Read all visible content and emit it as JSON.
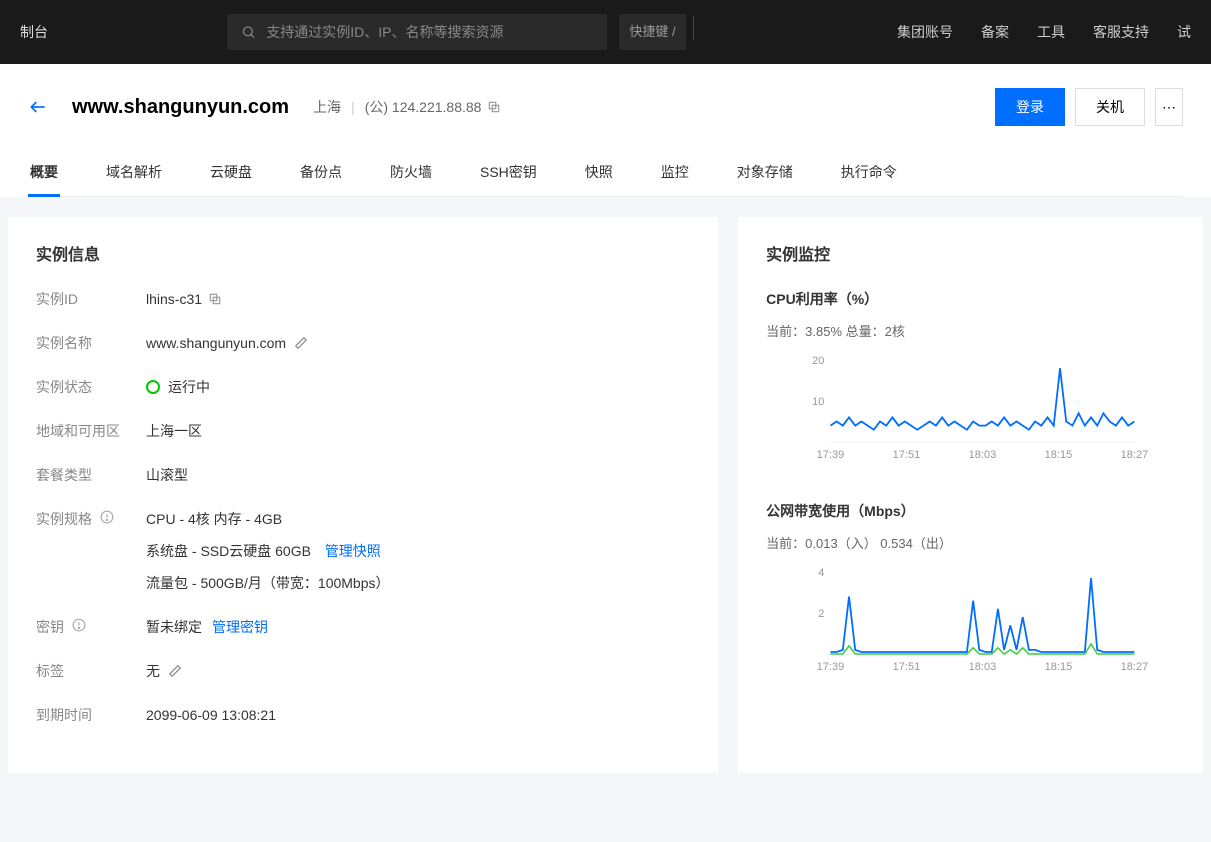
{
  "topbar": {
    "console": "制台",
    "search_placeholder": "支持通过实例ID、IP、名称等搜索资源",
    "shortcut": "快捷键 /",
    "links": [
      "集团账号",
      "备案",
      "工具",
      "客服支持",
      "试"
    ]
  },
  "header": {
    "title": "www.shangunyun.com",
    "region": "上海",
    "ip_label": "(公) 124.221.88.88",
    "login": "登录",
    "shutdown": "关机"
  },
  "tabs": [
    "概要",
    "域名解析",
    "云硬盘",
    "备份点",
    "防火墙",
    "SSH密钥",
    "快照",
    "监控",
    "对象存储",
    "执行命令"
  ],
  "info": {
    "panel_title": "实例信息",
    "rows": {
      "instance_id_label": "实例ID",
      "instance_id": "lhins-c31",
      "name_label": "实例名称",
      "name": "www.shangunyun.com",
      "status_label": "实例状态",
      "status": "运行中",
      "zone_label": "地域和可用区",
      "zone": "上海一区",
      "plan_label": "套餐类型",
      "plan": "山滚型",
      "spec_label": "实例规格",
      "spec_cpu": "CPU - 4核 内存 - 4GB",
      "spec_disk": "系统盘 - SSD云硬盘 60GB",
      "spec_disk_link": "管理快照",
      "spec_bw": "流量包 - 500GB/月（带宽：100Mbps）",
      "key_label": "密钥",
      "key": "暂未绑定",
      "key_link": "管理密钥",
      "tag_label": "标签",
      "tag": "无",
      "expire_label": "到期时间",
      "expire": "2099-06-09 13:08:21"
    }
  },
  "monitor": {
    "panel_title": "实例监控",
    "cpu_title": "CPU利用率（%）",
    "cpu_sub": "当前：3.85%  总量：2核",
    "bw_title": "公网带宽使用（Mbps）",
    "bw_sub": "当前：0.013（入） 0.534（出）"
  },
  "chart_data": [
    {
      "type": "line",
      "title": "CPU利用率（%）",
      "ylabel": "%",
      "ylim": [
        0,
        20
      ],
      "y_ticks": [
        10,
        20
      ],
      "x_ticks": [
        "17:39",
        "17:51",
        "18:03",
        "18:15",
        "18:27"
      ],
      "series": [
        {
          "name": "cpu",
          "values": [
            4,
            5,
            4,
            6,
            4,
            5,
            4,
            3,
            5,
            4,
            6,
            4,
            5,
            4,
            3,
            4,
            5,
            4,
            6,
            4,
            5,
            4,
            3,
            5,
            4,
            4,
            5,
            4,
            6,
            4,
            5,
            4,
            3,
            5,
            4,
            6,
            4,
            18,
            5,
            4,
            7,
            4,
            6,
            4,
            7,
            5,
            4,
            6,
            4,
            5
          ]
        }
      ]
    },
    {
      "type": "line",
      "title": "公网带宽使用（Mbps）",
      "ylabel": "Mbps",
      "ylim": [
        0,
        4
      ],
      "y_ticks": [
        2,
        4
      ],
      "x_ticks": [
        "17:39",
        "17:51",
        "18:03",
        "18:15",
        "18:27"
      ],
      "series": [
        {
          "name": "out",
          "values": [
            0.1,
            0.1,
            0.2,
            2.8,
            0.2,
            0.1,
            0.1,
            0.1,
            0.1,
            0.1,
            0.1,
            0.1,
            0.1,
            0.1,
            0.1,
            0.1,
            0.1,
            0.1,
            0.1,
            0.1,
            0.1,
            0.1,
            0.1,
            2.6,
            0.2,
            0.1,
            0.1,
            2.2,
            0.2,
            1.4,
            0.2,
            1.8,
            0.2,
            0.2,
            0.1,
            0.1,
            0.1,
            0.1,
            0.1,
            0.1,
            0.1,
            0.1,
            3.7,
            0.2,
            0.1,
            0.1,
            0.1,
            0.1,
            0.1,
            0.1
          ]
        },
        {
          "name": "in",
          "values": [
            0,
            0,
            0,
            0.4,
            0,
            0,
            0,
            0,
            0,
            0,
            0,
            0,
            0,
            0,
            0,
            0,
            0,
            0,
            0,
            0,
            0,
            0,
            0,
            0.3,
            0,
            0,
            0,
            0.3,
            0,
            0.2,
            0,
            0.3,
            0,
            0,
            0,
            0,
            0,
            0,
            0,
            0,
            0,
            0,
            0.5,
            0,
            0,
            0,
            0,
            0,
            0,
            0
          ]
        }
      ]
    }
  ]
}
